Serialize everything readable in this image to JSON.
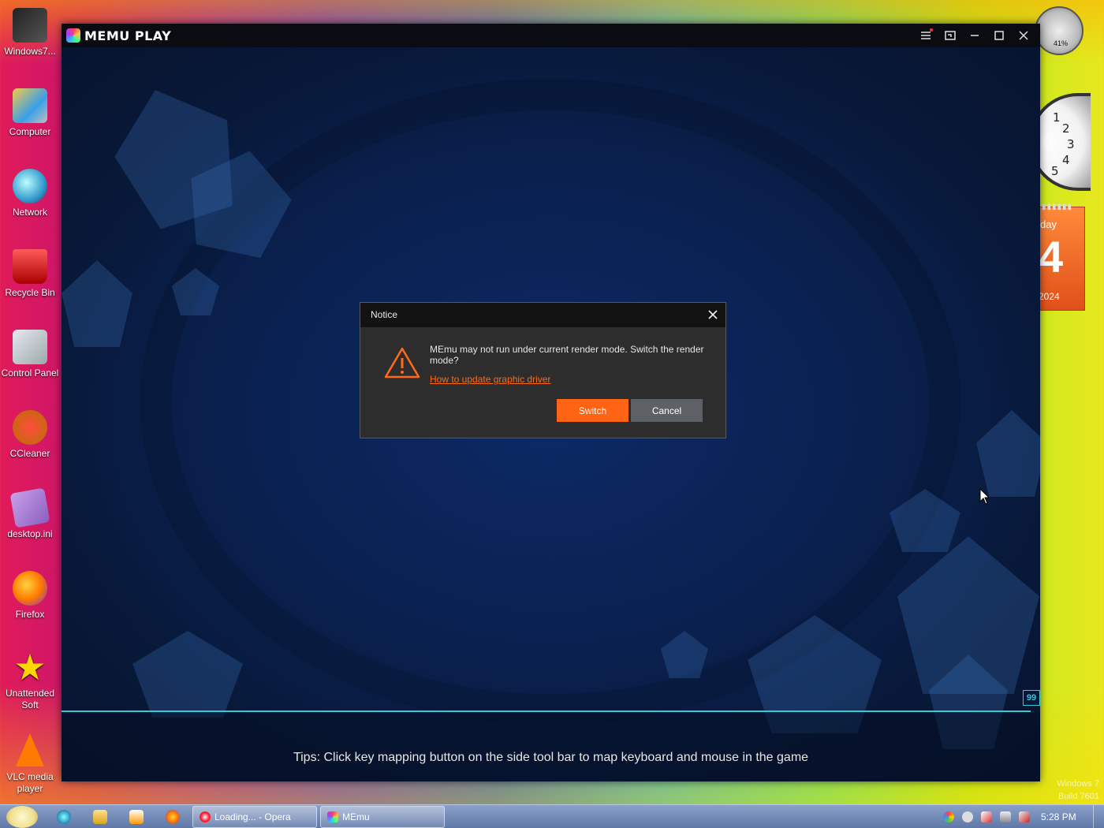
{
  "desktop": {
    "icons": [
      {
        "label": "Windows7..."
      },
      {
        "label": "Computer"
      },
      {
        "label": "Network"
      },
      {
        "label": "Recycle Bin"
      },
      {
        "label": "Control Panel"
      },
      {
        "label": "CCleaner"
      },
      {
        "label": "desktop.ini"
      },
      {
        "label": "Firefox"
      },
      {
        "label": "Unattended Soft"
      },
      {
        "label": "VLC media player"
      }
    ],
    "gadgets": {
      "meter_percent": "41%",
      "clock_numbers": [
        "1",
        "2",
        "3",
        "4",
        "5"
      ],
      "calendar_day": "day",
      "calendar_date": "4",
      "calendar_year": "2024"
    },
    "watermark": [
      "Windows 7",
      "Build 7601"
    ]
  },
  "memu": {
    "logo_text": "MEMU PLAY",
    "title_buttons": [
      "menu-icon",
      "screen-icon",
      "minimize-icon",
      "maximize-icon",
      "close-icon"
    ],
    "progress_badge": "99",
    "progress": 0.99,
    "tips": "Tips: Click key mapping button on the side tool bar to map keyboard and mouse in the game"
  },
  "dialog": {
    "title": "Notice",
    "message": "MEmu may not run under current render mode. Switch the render mode?",
    "link": "How to update graphic driver",
    "switch_label": "Switch",
    "cancel_label": "Cancel"
  },
  "taskbar": {
    "tasks": [
      {
        "label": "Loading... - Opera"
      },
      {
        "label": "MEmu"
      }
    ],
    "clock": "5:28 PM"
  },
  "colors": {
    "accent": "#ff6414",
    "progress": "#36c9d8",
    "link": "#ff6a1a"
  }
}
